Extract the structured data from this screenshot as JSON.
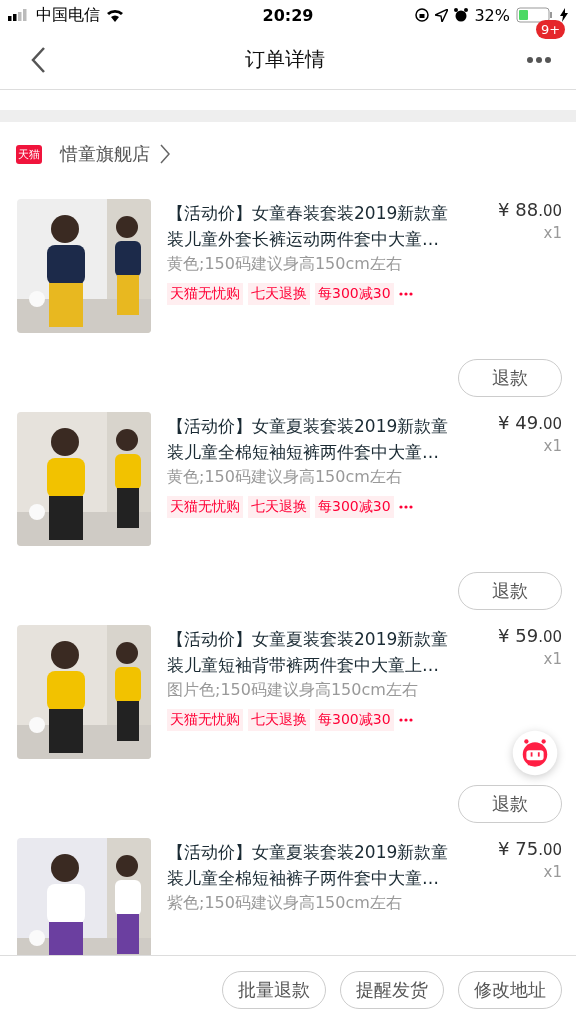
{
  "status_bar": {
    "carrier": "中国电信",
    "time": "20:29",
    "battery": "32%"
  },
  "nav": {
    "title": "订单详情",
    "badge": "9+"
  },
  "shop": {
    "badge": "天猫",
    "name": "惜童旗舰店"
  },
  "items": [
    {
      "title_lines": [
        "【活动价】女童春装套装2019新款童",
        "装儿童外套长裤运动两件套中大童…"
      ],
      "spec": "黄色;150码建议身高150cm左右",
      "price_main": "¥ 88",
      "price_cents": ".00",
      "quantity": "x1",
      "tags": [
        "天猫无忧购",
        "七天退换",
        "每300减30"
      ],
      "action": "退款"
    },
    {
      "title_lines": [
        "【活动价】女童夏装套装2019新款童",
        "装儿童全棉短袖短裤两件套中大童…"
      ],
      "spec": "黄色;150码建议身高150cm左右",
      "price_main": "¥ 49",
      "price_cents": ".00",
      "quantity": "x1",
      "tags": [
        "天猫无忧购",
        "七天退换",
        "每300减30"
      ],
      "action": "退款"
    },
    {
      "title_lines": [
        "【活动价】女童夏装套装2019新款童",
        "装儿童短袖背带裤两件套中大童上…"
      ],
      "spec": "图片色;150码建议身高150cm左右",
      "price_main": "¥ 59",
      "price_cents": ".00",
      "quantity": "x1",
      "tags": [
        "天猫无忧购",
        "七天退换",
        "每300减30"
      ],
      "action": "退款"
    },
    {
      "title_lines": [
        "【活动价】女童夏装套装2019新款童",
        "装儿童全棉短袖裤子两件套中大童…"
      ],
      "spec": "紫色;150码建议身高150cm左右",
      "price_main": "¥ 75",
      "price_cents": ".00",
      "quantity": "x1"
    }
  ],
  "bottom_actions": [
    "批量退款",
    "提醒发货",
    "修改地址"
  ]
}
